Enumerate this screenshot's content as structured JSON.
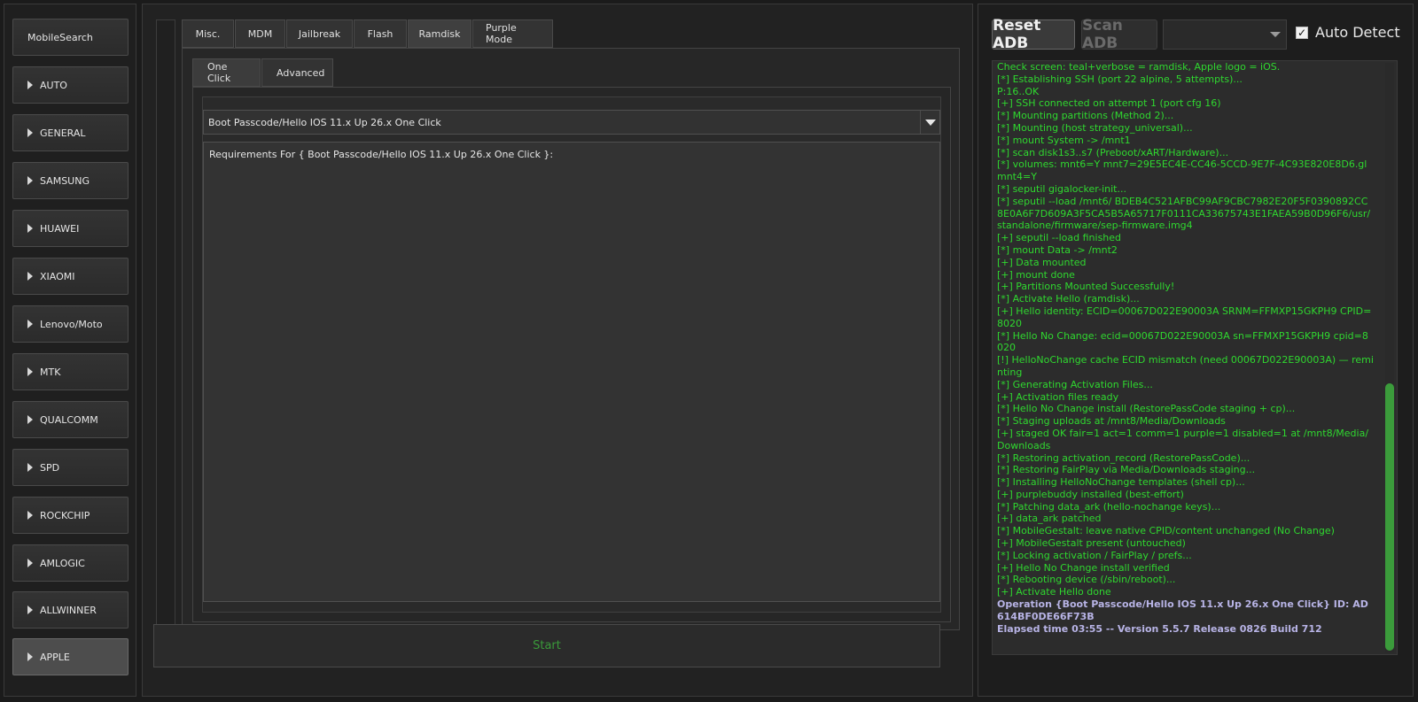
{
  "sidebar": {
    "items": [
      {
        "label": "MobileSearch",
        "has_arrow": false,
        "active": false
      },
      {
        "label": "AUTO",
        "has_arrow": true,
        "active": false
      },
      {
        "label": "GENERAL",
        "has_arrow": true,
        "active": false
      },
      {
        "label": "SAMSUNG",
        "has_arrow": true,
        "active": false
      },
      {
        "label": "HUAWEI",
        "has_arrow": true,
        "active": false
      },
      {
        "label": "XIAOMI",
        "has_arrow": true,
        "active": false
      },
      {
        "label": "Lenovo/Moto",
        "has_arrow": true,
        "active": false
      },
      {
        "label": "MTK",
        "has_arrow": true,
        "active": false
      },
      {
        "label": "QUALCOMM",
        "has_arrow": true,
        "active": false
      },
      {
        "label": "SPD",
        "has_arrow": true,
        "active": false
      },
      {
        "label": "ROCKCHIP",
        "has_arrow": true,
        "active": false
      },
      {
        "label": "AMLOGIC",
        "has_arrow": true,
        "active": false
      },
      {
        "label": "ALLWINNER",
        "has_arrow": true,
        "active": false
      },
      {
        "label": "APPLE",
        "has_arrow": true,
        "active": true
      }
    ]
  },
  "tabs": {
    "items": [
      "Misc.",
      "MDM",
      "Jailbreak",
      "Flash",
      "Ramdisk",
      "Purple Mode"
    ],
    "active": "Ramdisk"
  },
  "subtabs": {
    "items": [
      "One Click",
      "Advanced"
    ],
    "active": "One Click"
  },
  "mode_select": {
    "value": "Boot Passcode/Hello IOS 11.x Up 26.x One Click"
  },
  "requirements_text": "Requirements For { Boot Passcode/Hello IOS 11.x Up 26.x One Click }:",
  "start_label": "Start",
  "right": {
    "reset_adb": "Reset ADB",
    "scan_adb": "Scan ADB",
    "device_select_value": "",
    "auto_detect_label": "Auto Detect",
    "auto_detect_checked": true
  },
  "log": {
    "lines": [
      "Check screen: teal+verbose = ramdisk, Apple logo = iOS.",
      "[*] Establishing SSH (port 22 alpine, 5 attempts)...",
      "P:16..OK",
      "[+] SSH connected on attempt 1 (port cfg 16)",
      "[*] Mounting partitions (Method 2)...",
      "[*] Mounting (host strategy_universal)...",
      "[*] mount System -> /mnt1",
      "[*] scan disk1s3..s7 (Preboot/xART/Hardware)...",
      "[*] volumes: mnt6=Y mnt7=29E5EC4E-CC46-5CCD-9E7F-4C93E820E8D6.gl mnt4=Y",
      "[*] seputil gigalocker-init...",
      "[*] seputil --load /mnt6/ BDEB4C521AFBC99AF9CBC7982E20F5F0390892CC8E0A6F7D609A3F5CA5B5A65717F0111CA33675743E1FAEA59B0D96F6/usr/standalone/firmware/sep-firmware.img4",
      "[+] seputil --load finished",
      "[*] mount Data -> /mnt2",
      "[+] Data mounted",
      "[+] mount done",
      "[+] Partitions Mounted Successfully!",
      "[*] Activate Hello (ramdisk)...",
      "[+] Hello identity: ECID=00067D022E90003A SRNM=FFMXP15GKPH9 CPID=8020",
      "[*] Hello No Change: ecid=00067D022E90003A sn=FFMXP15GKPH9 cpid=8020",
      "[!] HelloNoChange cache ECID mismatch (need 00067D022E90003A) — reminting",
      "[*] Generating Activation Files...",
      "[+] Activation files ready",
      "[*] Hello No Change install (RestorePassCode staging + cp)...",
      "[*] Staging uploads at /mnt8/Media/Downloads",
      "[+] staged OK fair=1 act=1 comm=1 purple=1 disabled=1 at /mnt8/Media/ Downloads",
      "[*] Restoring activation_record (RestorePassCode)...",
      "[*] Restoring FairPlay via Media/Downloads staging...",
      "[*] Installing HelloNoChange templates (shell cp)...",
      "[+] purplebuddy installed (best-effort)",
      "[*] Patching data_ark (hello-nochange keys)...",
      "[+] data_ark patched",
      "[*] MobileGestalt: leave native CPID/content unchanged (No Change)",
      "[+] MobileGestalt present (untouched)",
      "[*] Locking activation / FairPlay / prefs...",
      "[+] Hello No Change install verified",
      "[*] Rebooting device (/sbin/reboot)...",
      "[+] Activate Hello done"
    ],
    "summary": [
      "Operation {Boot Passcode/Hello IOS 11.x Up 26.x One Click} ID: AD614BF0DE66F73B",
      "Elapsed time 03:55 -- Version 5.5.7 Release 0826 Build 712"
    ]
  },
  "colors": {
    "log_text": "#2fd82f",
    "log_summary": "#b8b4e6",
    "start_text": "#3a9a3a",
    "scroll_thumb": "#3b9b3b"
  }
}
